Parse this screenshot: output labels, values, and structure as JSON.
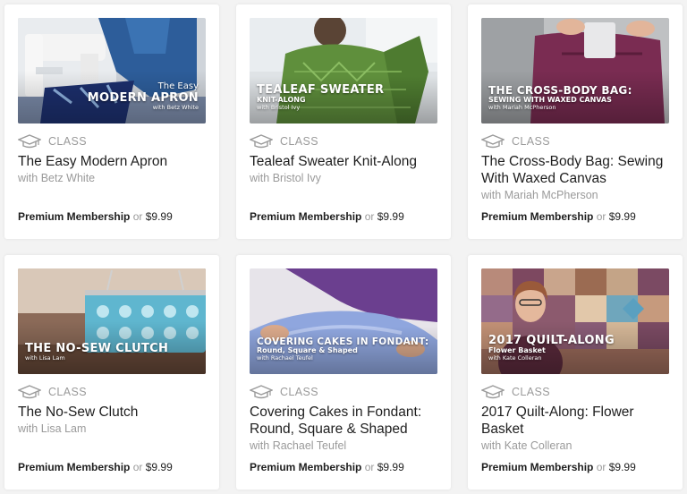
{
  "cards": [
    {
      "badge": "CLASS",
      "title": "The Easy Modern Apron",
      "instructor": "with Betz White",
      "membership": "Premium Membership",
      "or": " or ",
      "price": "$9.99",
      "thumb": {
        "top": "The Easy",
        "main": "MODERN APRON",
        "by": "with Betz White"
      }
    },
    {
      "badge": "CLASS",
      "title": "Tealeaf Sweater Knit-Along",
      "instructor": "with Bristol Ivy",
      "membership": "Premium Membership",
      "or": " or ",
      "price": "$9.99",
      "thumb": {
        "main": "TEALEAF SWEATER",
        "sub": "KNIT-ALONG",
        "by": "with Bristol Ivy"
      }
    },
    {
      "badge": "CLASS",
      "title": "The Cross-Body Bag: Sewing With Waxed Canvas",
      "instructor": "with Mariah McPherson",
      "membership": "Premium Membership",
      "or": " or ",
      "price": "$9.99",
      "thumb": {
        "main": "THE CROSS-BODY BAG:",
        "sub": "SEWING WITH WAXED CANVAS",
        "by": "with Mariah McPherson"
      }
    },
    {
      "badge": "CLASS",
      "title": "The No-Sew Clutch",
      "instructor": "with Lisa Lam",
      "membership": "Premium Membership",
      "or": " or ",
      "price": "$9.99",
      "thumb": {
        "main": "THE NO-SEW CLUTCH",
        "by": "with Lisa Lam"
      }
    },
    {
      "badge": "CLASS",
      "title": "Covering Cakes in Fondant: Round, Square & Shaped",
      "instructor": "with Rachael Teufel",
      "membership": "Premium Membership",
      "or": " or ",
      "price": "$9.99",
      "thumb": {
        "main": "COVERING CAKES IN FONDANT:",
        "sub": "Round, Square & Shaped",
        "by": "with Rachael Teufel"
      }
    },
    {
      "badge": "CLASS",
      "title": "2017 Quilt-Along: Flower Basket",
      "instructor": "with Kate Colleran",
      "membership": "Premium Membership",
      "or": " or ",
      "price": "$9.99",
      "thumb": {
        "main": "2017 QUILT-ALONG",
        "sub": "Flower Basket",
        "by": "with Kate Colleran"
      }
    }
  ],
  "colors": {
    "text": "#1e1e1e",
    "muted": "#9a9a9a",
    "card_bg": "#ffffff",
    "page_bg": "#f3f3f3"
  },
  "icons": {
    "badge": "graduation-cap-icon"
  }
}
